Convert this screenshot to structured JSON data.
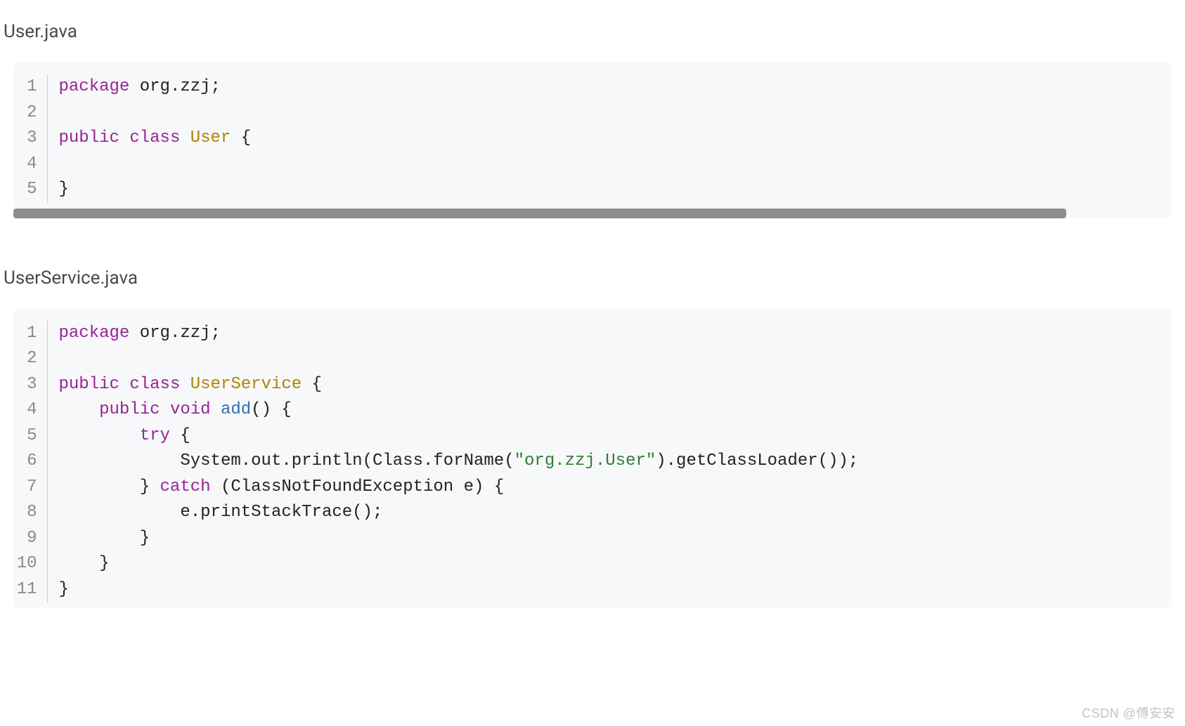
{
  "files": [
    {
      "filename": "User.java",
      "hasScrollbar": true,
      "lines": [
        [
          {
            "t": "package",
            "c": "kw"
          },
          {
            "t": " org.zzj;",
            "c": "pln"
          }
        ],
        [],
        [
          {
            "t": "public",
            "c": "kw"
          },
          {
            "t": " ",
            "c": "pln"
          },
          {
            "t": "class",
            "c": "kw"
          },
          {
            "t": " ",
            "c": "pln"
          },
          {
            "t": "User",
            "c": "cls"
          },
          {
            "t": " {",
            "c": "pln"
          }
        ],
        [],
        [
          {
            "t": "}",
            "c": "pln"
          }
        ]
      ]
    },
    {
      "filename": "UserService.java",
      "hasScrollbar": false,
      "lines": [
        [
          {
            "t": "package",
            "c": "kw"
          },
          {
            "t": " org.zzj;",
            "c": "pln"
          }
        ],
        [],
        [
          {
            "t": "public",
            "c": "kw"
          },
          {
            "t": " ",
            "c": "pln"
          },
          {
            "t": "class",
            "c": "kw"
          },
          {
            "t": " ",
            "c": "pln"
          },
          {
            "t": "UserService",
            "c": "cls"
          },
          {
            "t": " {",
            "c": "pln"
          }
        ],
        [
          {
            "t": "    ",
            "c": "pln"
          },
          {
            "t": "public",
            "c": "kw"
          },
          {
            "t": " ",
            "c": "pln"
          },
          {
            "t": "void",
            "c": "kw"
          },
          {
            "t": " ",
            "c": "pln"
          },
          {
            "t": "add",
            "c": "fn"
          },
          {
            "t": "() {",
            "c": "pln"
          }
        ],
        [
          {
            "t": "        ",
            "c": "pln"
          },
          {
            "t": "try",
            "c": "kw"
          },
          {
            "t": " {",
            "c": "pln"
          }
        ],
        [
          {
            "t": "            System.out.println(Class.forName(",
            "c": "pln"
          },
          {
            "t": "\"org.zzj.User\"",
            "c": "str"
          },
          {
            "t": ").getClassLoader());",
            "c": "pln"
          }
        ],
        [
          {
            "t": "        } ",
            "c": "pln"
          },
          {
            "t": "catch",
            "c": "kw"
          },
          {
            "t": " (ClassNotFoundException e) {",
            "c": "pln"
          }
        ],
        [
          {
            "t": "            e.printStackTrace();",
            "c": "pln"
          }
        ],
        [
          {
            "t": "        }",
            "c": "pln"
          }
        ],
        [
          {
            "t": "    }",
            "c": "pln"
          }
        ],
        [
          {
            "t": "}",
            "c": "pln"
          }
        ]
      ]
    }
  ],
  "watermark": "CSDN @傅安安"
}
